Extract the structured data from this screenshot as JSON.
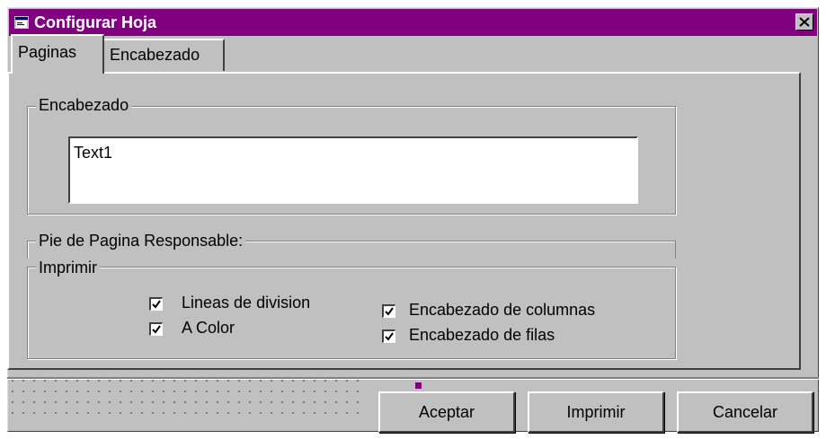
{
  "window": {
    "title": "Configurar Hoja",
    "close_glyph": "✕",
    "accent_color": "#800080"
  },
  "tabs": [
    {
      "label": "Paginas",
      "active": true
    },
    {
      "label": "Encabezado",
      "active": false
    }
  ],
  "header_group": {
    "label": "Encabezado",
    "textbox_value": "Text1"
  },
  "footer_group": {
    "label": "Pie de Pagina Responsable:"
  },
  "print_group": {
    "label": "Imprimir",
    "checkboxes": [
      {
        "label": "Lineas de division",
        "checked": true
      },
      {
        "label": "A Color",
        "checked": true
      },
      {
        "label": "Encabezado de columnas",
        "checked": true
      },
      {
        "label": "Encabezado de filas",
        "checked": true
      }
    ]
  },
  "buttons": {
    "accept": "Aceptar",
    "print": "Imprimir",
    "cancel": "Cancelar"
  },
  "icons": [
    "window-icon",
    "close-icon",
    "checkmark-icon"
  ]
}
